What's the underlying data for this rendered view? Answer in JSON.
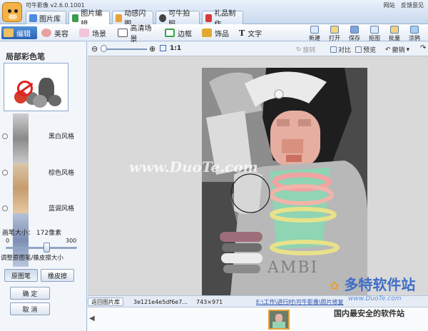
{
  "app": {
    "title": "可牛影像 v2.6.0.1001",
    "links": [
      "网站",
      "反馈意见"
    ]
  },
  "main_tabs": [
    {
      "label": "图片库"
    },
    {
      "label": "图片编辑"
    },
    {
      "label": "动感闪图"
    },
    {
      "label": "可牛拍照"
    },
    {
      "label": "礼品制作"
    }
  ],
  "function_tabs": [
    {
      "label": "编辑"
    },
    {
      "label": "美容"
    },
    {
      "label": "场景"
    },
    {
      "label": "高清场景"
    },
    {
      "label": "边框"
    },
    {
      "label": "饰品"
    },
    {
      "label": "文字"
    }
  ],
  "right_tools": [
    {
      "label": "新建"
    },
    {
      "label": "打开"
    },
    {
      "label": "保存"
    },
    {
      "label": "抠图"
    },
    {
      "label": "批量"
    },
    {
      "label": "涂鸦"
    }
  ],
  "view_toolbar": {
    "zoom_level": "1:1",
    "rotate": "旋转",
    "compare": "对比",
    "preview": "预览",
    "undo": "撤销"
  },
  "left_panel": {
    "title": "局部彩色笔",
    "styles": [
      {
        "label": "黑白风格"
      },
      {
        "label": "棕色风格"
      },
      {
        "label": "蓝调风格"
      }
    ],
    "brush_size_label": "画笔大小：",
    "brush_size_value": "172像素",
    "slider": {
      "min": "0",
      "max": "300",
      "value": 172
    },
    "adjust_hint": "调整原图笔/橡皮擦大小",
    "tool_buttons": [
      {
        "label": "原图笔"
      },
      {
        "label": "橡皮擦"
      }
    ],
    "confirm": "确 定",
    "cancel": "取 消"
  },
  "status_bar": {
    "back": "返回图片库",
    "filename": "3e121e4e5df6e7...",
    "dimensions": "743×971",
    "path": "E:\\工作\\进行时\\可牛影像\\照片修复"
  },
  "watermarks": {
    "center": "www.DuoTe.com",
    "site_name": "多特软件站",
    "site_url": "www.DuoTe.com",
    "slogan": "国内最安全的软件站"
  },
  "photo_text": "AMBI"
}
